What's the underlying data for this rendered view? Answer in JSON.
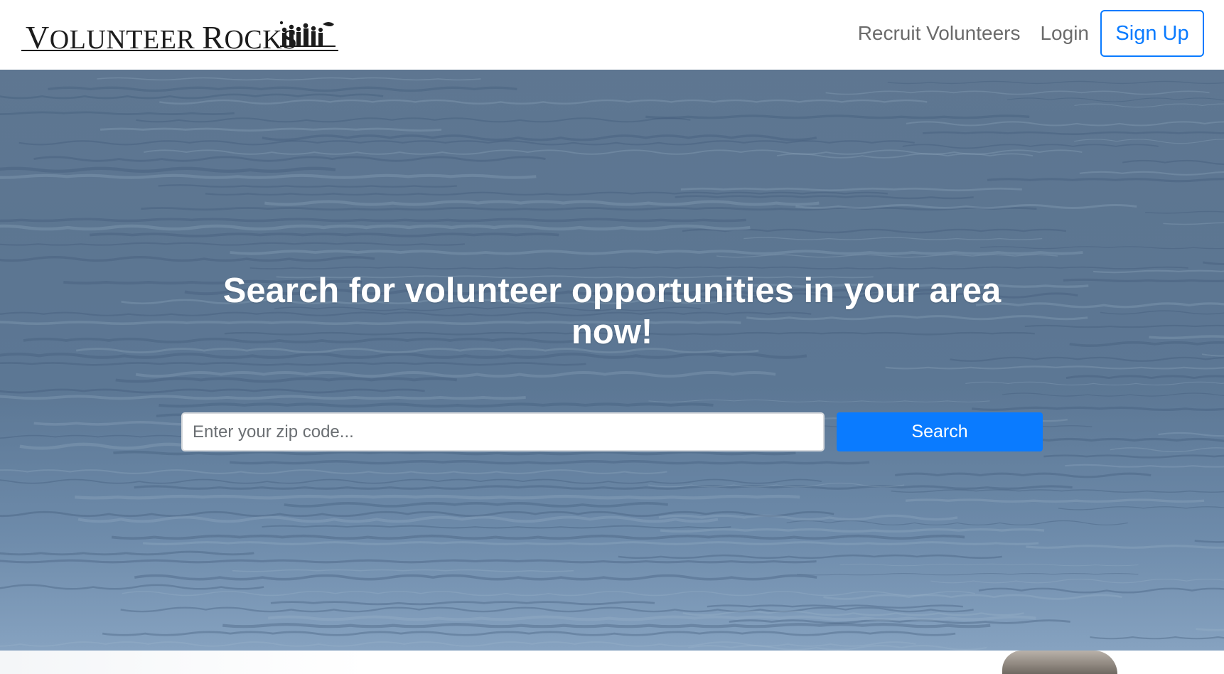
{
  "navbar": {
    "brand_name": "VOLUNTEER ROCKS",
    "links": {
      "recruit": "Recruit Volunteers",
      "login": "Login",
      "signup": "Sign Up"
    }
  },
  "hero": {
    "title": "Search for volunteer opportunities in your area now!",
    "search": {
      "placeholder": "Enter your zip code...",
      "button_label": "Search"
    }
  },
  "colors": {
    "accent": "#0a7bff",
    "nav_text": "#6b6b6b",
    "hero_text": "#ffffff"
  }
}
